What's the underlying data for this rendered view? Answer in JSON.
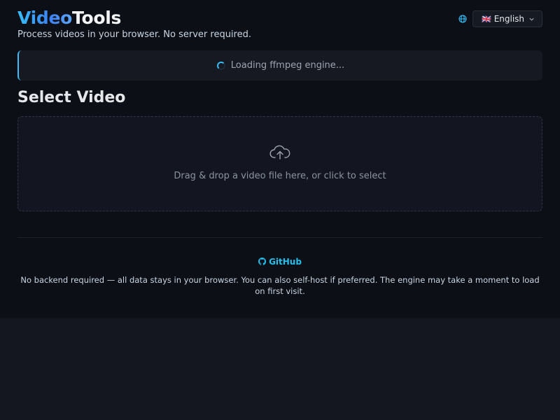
{
  "header": {
    "logo_part1": "Video",
    "logo_part2": "Tools",
    "tagline": "Process videos in your browser. No server required.",
    "language": {
      "flag": "🇬🇧",
      "selected": "English",
      "icon": "globe-icon"
    }
  },
  "status": {
    "text": "Loading ffmpeg engine...",
    "icon": "spinner-icon"
  },
  "upload": {
    "heading": "Select Video",
    "hint": "Drag & drop a video file here, or click to select",
    "icon": "cloud-upload-icon"
  },
  "footer": {
    "github_label": "GitHub",
    "note": "No backend required — all data stays in your browser. You can also self-host if preferred. The engine may take a moment to load on first visit."
  },
  "colors": {
    "accent": "#22c0ef",
    "background": "#0c0f16",
    "page_background": "#141720",
    "panel": "#161922"
  }
}
